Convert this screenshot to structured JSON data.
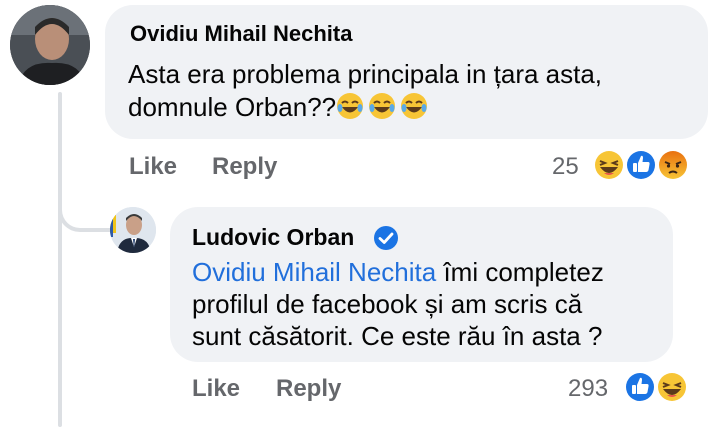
{
  "comment": {
    "author": "Ovidiu Mihail Nechita",
    "text_line1": "Asta era problema principala in țara asta,",
    "text_line2": "domnule Orban??",
    "trailing_emojis": [
      "laughing-emoji",
      "laughing-emoji",
      "laughing-emoji"
    ],
    "actions": {
      "like": "Like",
      "reply": "Reply"
    },
    "reaction_count": "25",
    "reactions": [
      "haha",
      "like",
      "angry"
    ]
  },
  "reply": {
    "author": "Ludovic Orban",
    "verified": true,
    "mention": "Ovidiu Mihail Nechita",
    "text_line1_rest": " îmi completez",
    "text_line2": "profilul de facebook și am scris că",
    "text_line3": "sunt căsătorit. Ce este rău în asta ?",
    "actions": {
      "like": "Like",
      "reply": "Reply"
    },
    "reaction_count": "293",
    "reactions": [
      "like",
      "haha"
    ]
  },
  "colors": {
    "bubble": "#f0f2f5",
    "mention": "#216fdb",
    "meta": "#65676b",
    "like_blue": "#1b74e4",
    "haha_yellow": "#f7c536",
    "angry_red": "#e9710f"
  }
}
